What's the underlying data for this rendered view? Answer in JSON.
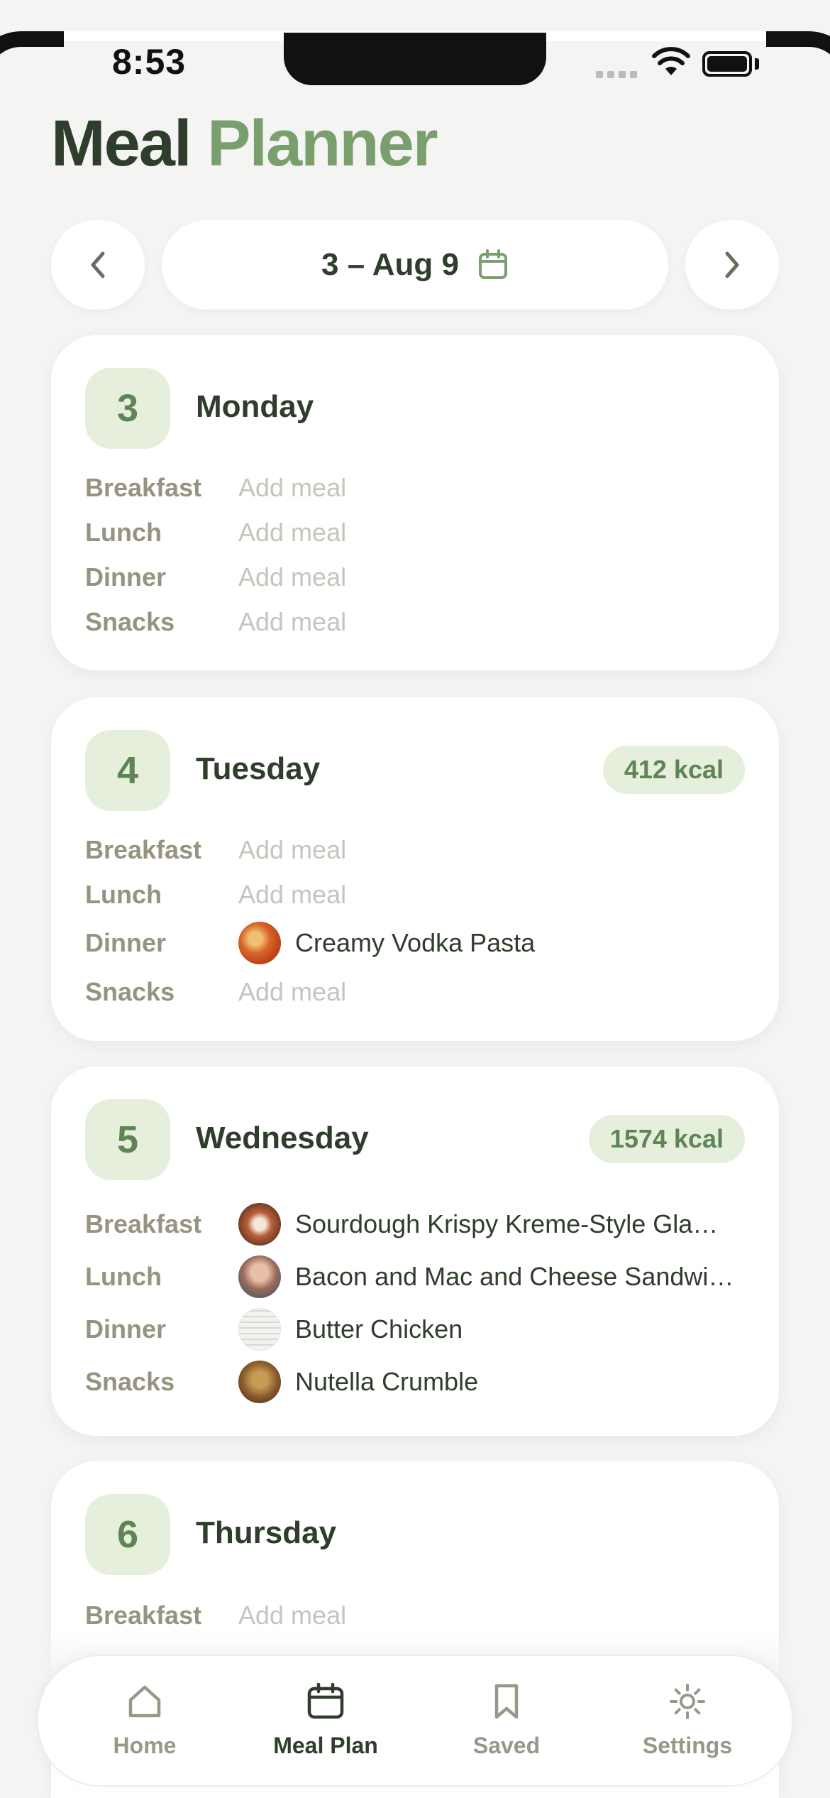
{
  "status_bar": {
    "time": "8:53"
  },
  "header": {
    "title_part1": "Meal",
    "title_part2": "Planner"
  },
  "week_nav": {
    "label": "3 – Aug 9"
  },
  "days": [
    {
      "number": "3",
      "name": "Monday",
      "kcal": "",
      "meals": [
        {
          "label": "Breakfast",
          "value": "Add meal"
        },
        {
          "label": "Lunch",
          "value": "Add meal"
        },
        {
          "label": "Dinner",
          "value": "Add meal"
        },
        {
          "label": "Snacks",
          "value": "Add meal"
        }
      ]
    },
    {
      "number": "4",
      "name": "Tuesday",
      "kcal": "412 kcal",
      "meals": [
        {
          "label": "Breakfast",
          "value": "Add meal"
        },
        {
          "label": "Lunch",
          "value": "Add meal"
        },
        {
          "label": "Dinner",
          "value": "Creamy Vodka Pasta"
        },
        {
          "label": "Snacks",
          "value": "Add meal"
        }
      ]
    },
    {
      "number": "5",
      "name": "Wednesday",
      "kcal": "1574 kcal",
      "meals": [
        {
          "label": "Breakfast",
          "value": "Sourdough Krispy Kreme-Style Gla…"
        },
        {
          "label": "Lunch",
          "value": "Bacon and Mac and Cheese Sandwi…"
        },
        {
          "label": "Dinner",
          "value": "Butter Chicken"
        },
        {
          "label": "Snacks",
          "value": "Nutella Crumble"
        }
      ]
    },
    {
      "number": "6",
      "name": "Thursday",
      "kcal": "",
      "meals": [
        {
          "label": "Breakfast",
          "value": "Add meal"
        }
      ]
    }
  ],
  "tabbar": {
    "tabs": [
      {
        "label": "Home",
        "icon": "house-icon"
      },
      {
        "label": "Meal Plan",
        "icon": "calendar-icon",
        "active": true
      },
      {
        "label": "Saved",
        "icon": "bookmark-icon"
      },
      {
        "label": "Settings",
        "icon": "sun-icon"
      }
    ]
  },
  "colors": {
    "accent": "#7a9f6f",
    "dark_green": "#2f3d2c",
    "badge_bg": "#e6efdc",
    "background": "#f4f4f2"
  }
}
